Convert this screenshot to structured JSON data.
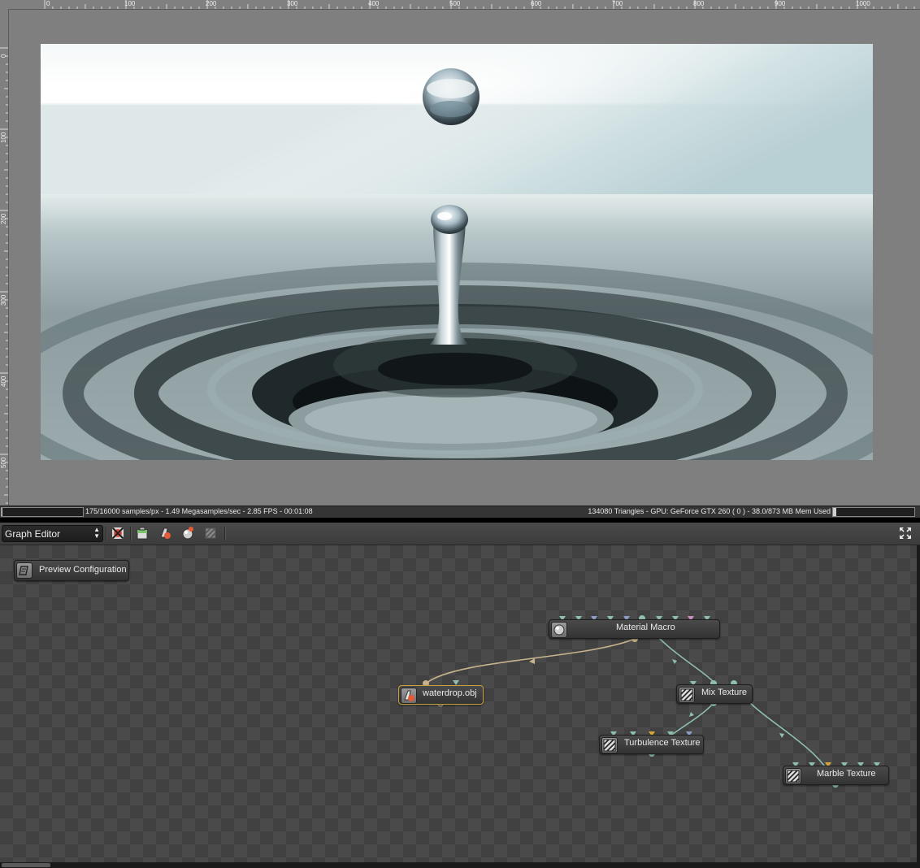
{
  "ruler": {
    "top_labels": [
      "0",
      "100",
      "200",
      "300",
      "400",
      "500",
      "600",
      "700",
      "800",
      "900",
      "1000"
    ],
    "left_labels": [
      "0",
      "100",
      "200",
      "300",
      "400",
      "500"
    ]
  },
  "viewport": {
    "image": "water-drop-splash-render"
  },
  "status": {
    "left": "175/16000 samples/px - 1.49 Megasamples/sec - 2.85 FPS - 00:01:08",
    "right": "134080 Triangles - GPU: GeForce GTX 260 ( 0 ) - 38.0/873 MB Mem Used",
    "render_progress": 0.011,
    "memory_used": 0.044
  },
  "graph_editor": {
    "editor_type": "Graph Editor",
    "toolbar_icons": [
      "delete-nodes-icon",
      "add-scene-icon",
      "add-object-icon",
      "add-material-icon",
      "add-texture-icon"
    ],
    "nodes": {
      "preview": "Preview Configuration",
      "material_macro": "Material Macro",
      "waterdrop": "waterdrop.obj",
      "mix_texture": "Mix Texture",
      "turbulence_texture": "Turbulence Texture",
      "marble_texture": "Marble Texture"
    }
  },
  "colors": {
    "wire_texture": "#8fbfae",
    "wire_material": "#c8b48c",
    "canvas_dark": "#414141",
    "canvas_light": "#4a4a4a"
  }
}
